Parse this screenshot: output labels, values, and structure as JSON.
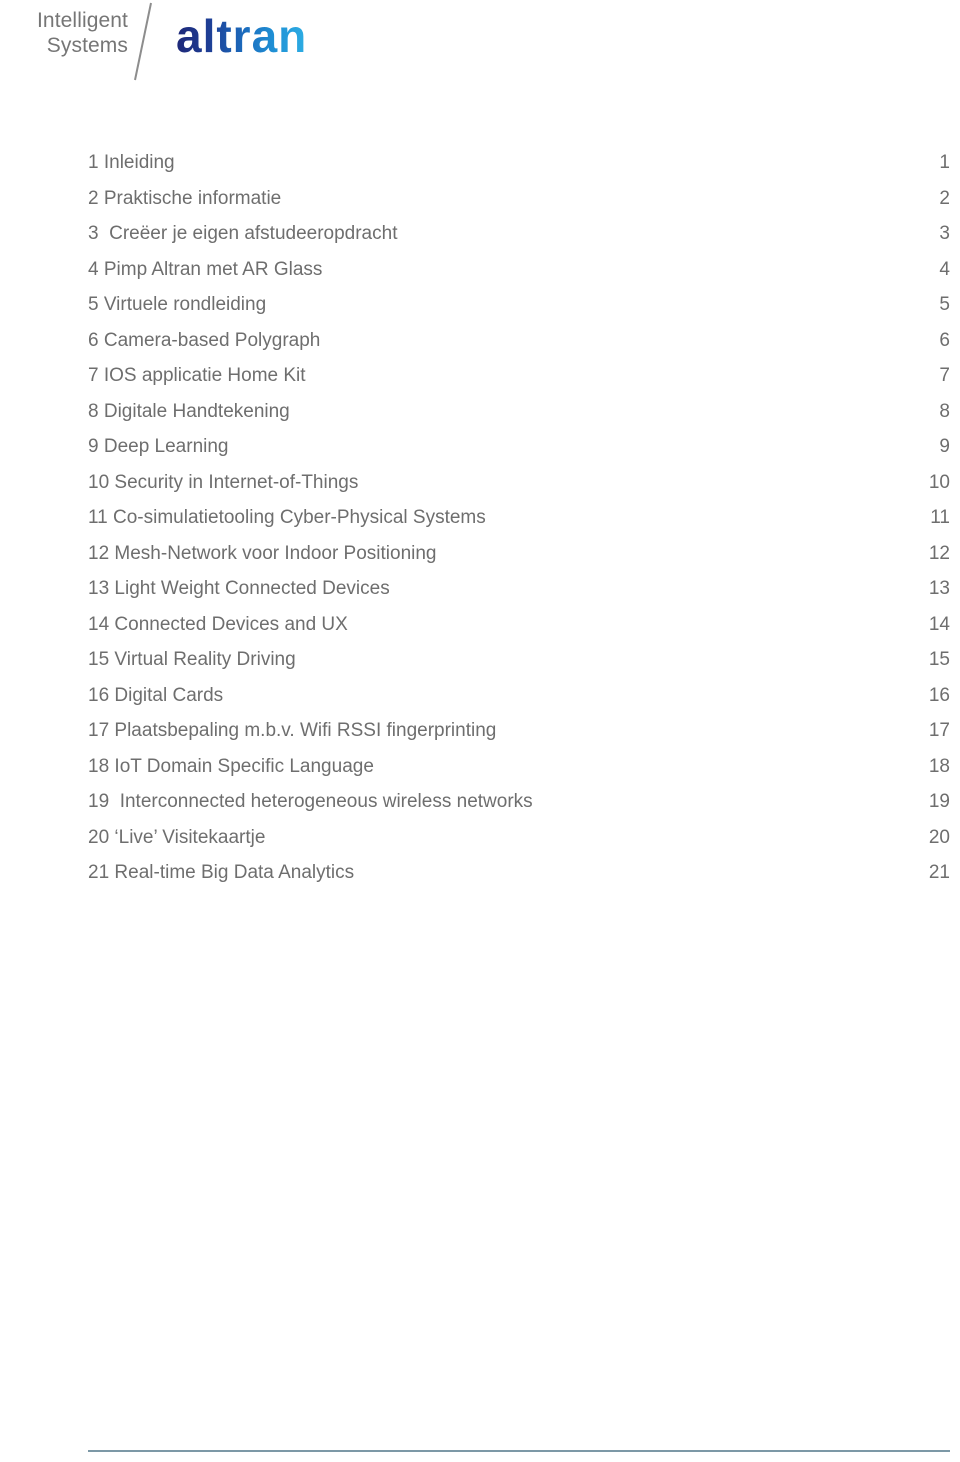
{
  "header": {
    "brand_left_line1": "Intelligent",
    "brand_left_line2": "Systems",
    "brand_right": "altran",
    "brand_left_color": "#767676",
    "brand_right_gradient_start": "#1e2878",
    "brand_right_gradient_end": "#2daee4",
    "divider_icon": "diagonal-slash-icon"
  },
  "toc": {
    "text_color": "#6e6e6e",
    "rows": [
      {
        "title": "1 Inleiding",
        "page": "1"
      },
      {
        "title": "2 Praktische informatie",
        "page": "2"
      },
      {
        "title": "3  Creëer je eigen afstudeeropdracht",
        "page": "3"
      },
      {
        "title": "4 Pimp Altran met AR Glass",
        "page": "4"
      },
      {
        "title": "5 Virtuele rondleiding",
        "page": "5"
      },
      {
        "title": "6 Camera-based Polygraph",
        "page": "6"
      },
      {
        "title": "7 IOS applicatie Home Kit",
        "page": "7"
      },
      {
        "title": "8 Digitale Handtekening",
        "page": "8"
      },
      {
        "title": "9 Deep Learning",
        "page": "9"
      },
      {
        "title": "10 Security in Internet-of-Things",
        "page": "10"
      },
      {
        "title": "11 Co-simulatietooling Cyber-Physical Systems",
        "page": "11"
      },
      {
        "title": "12 Mesh-Network voor Indoor Positioning",
        "page": "12"
      },
      {
        "title": "13 Light Weight Connected Devices",
        "page": "13"
      },
      {
        "title": "14 Connected Devices and UX",
        "page": "14"
      },
      {
        "title": "15 Virtual Reality Driving",
        "page": "15"
      },
      {
        "title": "16 Digital Cards",
        "page": "16"
      },
      {
        "title": "17 Plaatsbepaling m.b.v. Wifi RSSI fingerprinting",
        "page": "17"
      },
      {
        "title": "18 IoT Domain Specific Language",
        "page": "18"
      },
      {
        "title": "19  Interconnected heterogeneous wireless networks",
        "page": "19"
      },
      {
        "title": "20 ‘Live’ Visitekaartje",
        "page": "20"
      },
      {
        "title": "21 Real-time Big Data Analytics",
        "page": "21"
      }
    ]
  },
  "footer": {
    "rule_color": "#7c98a6"
  }
}
